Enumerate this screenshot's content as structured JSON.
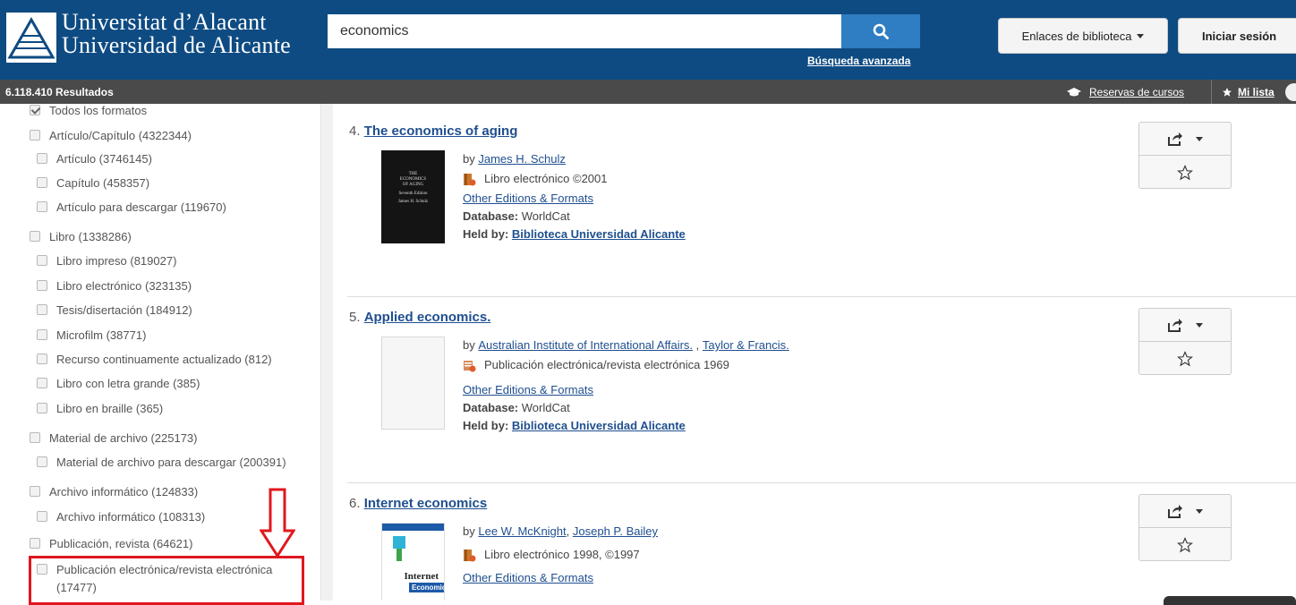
{
  "header": {
    "uni_name_line1": "Universitat d’Alacant",
    "uni_name_line2": "Universidad de Alicante",
    "search_value": "economics",
    "advanced_search": "Búsqueda avanzada",
    "library_links": "Enlaces de biblioteca",
    "login": "Iniciar sesión"
  },
  "results_bar": {
    "count": "6.118.410 Resultados",
    "course_reserves": "Reservas de cursos",
    "my_list": "Mi lista"
  },
  "facets": [
    {
      "label": "Todos los formatos",
      "checked": true
    },
    {
      "label": "Artículo/Capítulo (4322344)"
    },
    {
      "label": "Artículo (3746145)"
    },
    {
      "label": "Capítulo (458357)"
    },
    {
      "label": "Artículo para descargar (119670)"
    },
    {
      "label": "Libro (1338286)"
    },
    {
      "label": "Libro impreso (819027)"
    },
    {
      "label": "Libro electrónico (323135)"
    },
    {
      "label": "Tesis/disertación (184912)"
    },
    {
      "label": "Microfilm (38771)"
    },
    {
      "label": "Recurso continuamente actualizado (812)"
    },
    {
      "label": "Libro con letra grande (385)"
    },
    {
      "label": "Libro en braille (365)"
    },
    {
      "label": "Material de archivo (225173)"
    },
    {
      "label": "Material de archivo para descargar (200391)"
    },
    {
      "label": "Archivo informático (124833)"
    },
    {
      "label": "Archivo informático (108313)"
    },
    {
      "label": "Publicación, revista (64621)"
    },
    {
      "label": "Publicación electrónica/revista electrónica (17477)"
    }
  ],
  "results": [
    {
      "number": "4.",
      "title": "The economics of aging",
      "by_prefix": "by",
      "authors": [
        "James H. Schulz"
      ],
      "format": "Libro electrónico ©2001",
      "editions": "Other Editions & Formats",
      "database_label": "Database:",
      "database": "WorldCat",
      "held_label": "Held by:",
      "held_by": "Biblioteca Universidad Alicante",
      "cover_text": [
        "THE",
        "ECONOMICS",
        "OF AGING",
        "Seventh Edition",
        "James H. Schulz"
      ]
    },
    {
      "number": "5.",
      "title": "Applied economics.",
      "by_prefix": "by",
      "authors": [
        "Australian Institute of International Affairs.",
        "Taylor & Francis."
      ],
      "format": "Publicación electrónica/revista electrónica 1969",
      "editions": "Other Editions & Formats",
      "database_label": "Database:",
      "database": "WorldCat",
      "held_label": "Held by:",
      "held_by": "Biblioteca Universidad Alicante"
    },
    {
      "number": "6.",
      "title": "Internet economics",
      "by_prefix": "by",
      "authors": [
        "Lee W. McKnight",
        "Joseph P. Bailey"
      ],
      "format": "Libro electrónico 1998, ©1997",
      "editions": "Other Editions & Formats",
      "cover_text": [
        "Internet",
        "Economics"
      ]
    }
  ],
  "colors": {
    "header_bg": "#0e4b82",
    "search_button": "#2f7dc2",
    "results_bar": "#4a4a4a",
    "link": "#1f4f8f",
    "annotation_red": "#e0171e"
  },
  "icons": {
    "search": "search-icon",
    "share": "share-icon",
    "favorite": "star-icon",
    "course_reserves": "graduation-cap-icon",
    "my_list": "star-icon",
    "logo": "university-logo"
  }
}
